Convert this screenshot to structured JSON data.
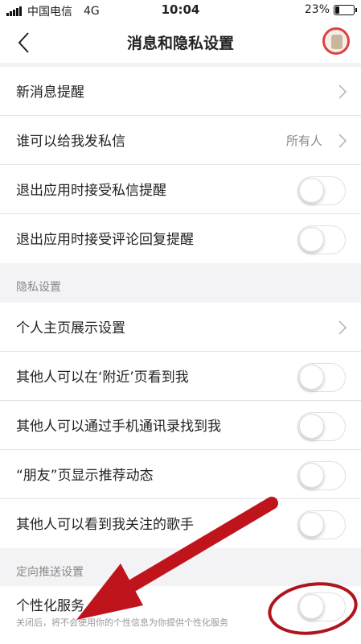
{
  "status_bar": {
    "carrier": "中国电信",
    "network": "4G",
    "time": "10:04",
    "battery_percent": "23%",
    "battery_level": 0.23
  },
  "header": {
    "title": "消息和隐私设置"
  },
  "message_section": {
    "items": [
      {
        "label": "新消息提醒",
        "type": "link"
      },
      {
        "label": "谁可以给我发私信",
        "value": "所有人",
        "type": "link"
      },
      {
        "label": "退出应用时接受私信提醒",
        "type": "toggle",
        "on": false
      },
      {
        "label": "退出应用时接受评论回复提醒",
        "type": "toggle",
        "on": false
      }
    ]
  },
  "privacy_section": {
    "header": "隐私设置",
    "items": [
      {
        "label": "个人主页展示设置",
        "type": "link"
      },
      {
        "label": "其他人可以在‘附近’页看到我",
        "type": "toggle",
        "on": false
      },
      {
        "label": "其他人可以通过手机通讯录找到我",
        "type": "toggle",
        "on": false
      },
      {
        "label": "“朋友”页显示推荐动态",
        "type": "toggle",
        "on": false
      },
      {
        "label": "其他人可以看到我关注的歌手",
        "type": "toggle",
        "on": false
      }
    ]
  },
  "targeted_section": {
    "header": "定向推送设置",
    "item": {
      "label": "个性化服务",
      "description": "关闭后，将不会使用你的个性信息为你提供个性化服务",
      "type": "toggle",
      "on": false
    }
  },
  "annotation": {
    "arrow_color": "#c0141c",
    "circle_color": "#b0141c"
  }
}
